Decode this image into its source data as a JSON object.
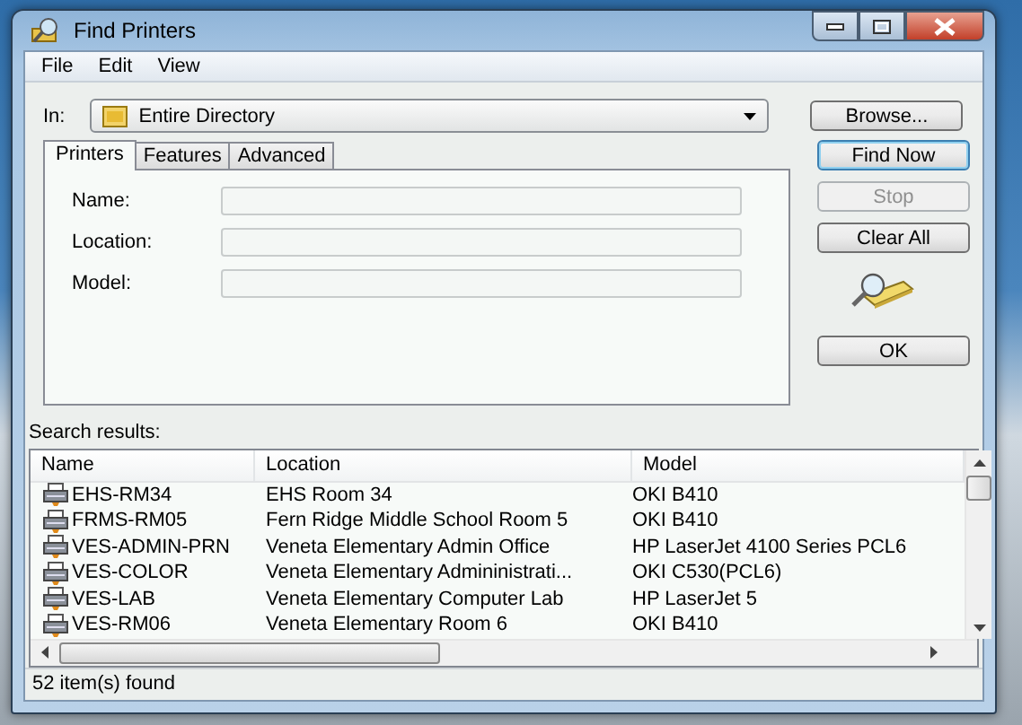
{
  "window": {
    "title": "Find Printers"
  },
  "menu": [
    {
      "label": "File"
    },
    {
      "label": "Edit"
    },
    {
      "label": "View"
    }
  ],
  "scope": {
    "label": "In:",
    "value": "Entire Directory"
  },
  "browse_button": {
    "label": "Browse..."
  },
  "tabs": [
    {
      "label": "Printers",
      "selected": true
    },
    {
      "label": "Features",
      "selected": false
    },
    {
      "label": "Advanced",
      "selected": false
    }
  ],
  "fields": [
    {
      "label": "Name:"
    },
    {
      "label": "Location:"
    },
    {
      "label": "Model:"
    }
  ],
  "buttons": [
    {
      "label": "Find Now",
      "kind": "default",
      "disabled": false
    },
    {
      "label": "Stop",
      "kind": "normal",
      "disabled": true
    },
    {
      "label": "Clear All",
      "kind": "normal",
      "disabled": false
    }
  ],
  "ok_button": {
    "label": "OK"
  },
  "results": {
    "label": "Search results:",
    "columns": [
      {
        "label": "Name"
      },
      {
        "label": "Location"
      },
      {
        "label": "Model"
      }
    ],
    "rows": [
      {
        "name": "EHS-RM34",
        "location": "EHS Room 34",
        "model": "OKI B410"
      },
      {
        "name": "FRMS-RM05",
        "location": "Fern Ridge Middle School Room 5",
        "model": "OKI B410"
      },
      {
        "name": "VES-ADMIN-PRN",
        "location": "Veneta Elementary Admin Office",
        "model": "HP LaserJet 4100 Series PCL6"
      },
      {
        "name": "VES-COLOR",
        "location": "Veneta Elementary Admininistrati...",
        "model": "OKI C530(PCL6)"
      },
      {
        "name": "VES-LAB",
        "location": "Veneta Elementary Computer Lab",
        "model": "HP LaserJet 5"
      },
      {
        "name": "VES-RM06",
        "location": "Veneta Elementary Room 6",
        "model": "OKI B410"
      }
    ]
  },
  "status_bar": {
    "text": "52 item(s) found"
  }
}
